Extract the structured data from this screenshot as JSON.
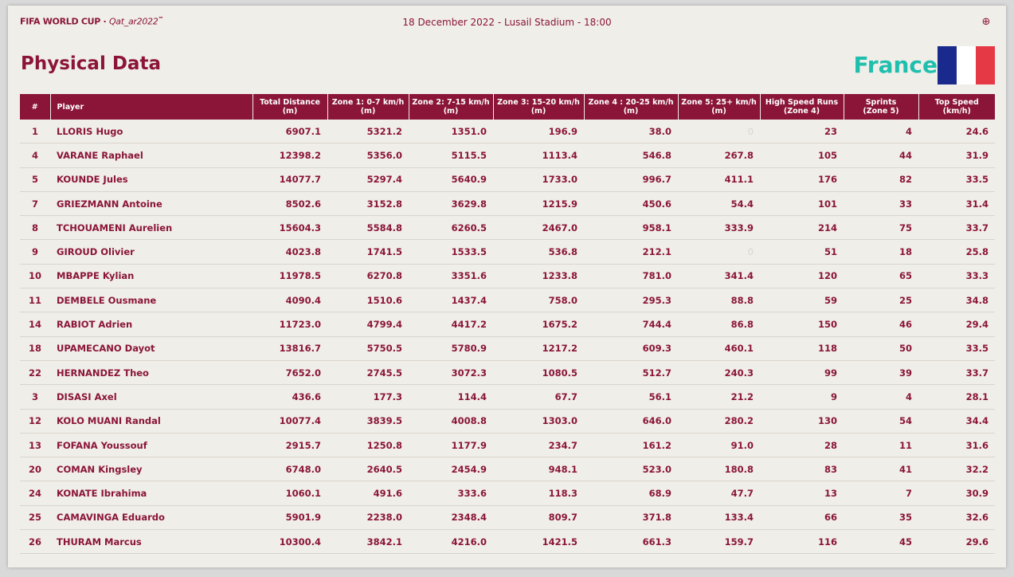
{
  "header": {
    "logo_text": "FIFA WORLD CUP",
    "logo_sub": "Qat_ar2022",
    "logo_tm": "™",
    "match_info": "18 December 2022 - Lusail Stadium - 18:00",
    "globe_icon": "globe-icon"
  },
  "title": "Physical Data",
  "team": {
    "name": "France",
    "flag_colors": [
      "#1a2a8c",
      "#ffffff",
      "#e63946"
    ]
  },
  "colors": {
    "primary": "#8a1538",
    "accent": "#1fbfae",
    "background": "#f0eee8"
  },
  "table": {
    "columns": [
      {
        "l1": "#",
        "l2": ""
      },
      {
        "l1": "Player",
        "l2": ""
      },
      {
        "l1": "Total Distance",
        "l2": "(m)"
      },
      {
        "l1": "Zone 1: 0-7 km/h",
        "l2": "(m)"
      },
      {
        "l1": "Zone 2: 7-15 km/h",
        "l2": "(m)"
      },
      {
        "l1": "Zone 3: 15-20 km/h",
        "l2": "(m)"
      },
      {
        "l1": "Zone 4 : 20-25 km/h",
        "l2": "(m)"
      },
      {
        "l1": "Zone 5: 25+ km/h",
        "l2": "(m)"
      },
      {
        "l1": "High Speed Runs",
        "l2": "(Zone 4)"
      },
      {
        "l1": "Sprints",
        "l2": "(Zone 5)"
      },
      {
        "l1": "Top Speed",
        "l2": "(km/h)"
      }
    ],
    "rows": [
      [
        "1",
        "LLORIS Hugo",
        "6907.1",
        "5321.2",
        "1351.0",
        "196.9",
        "38.0",
        "0",
        "23",
        "4",
        "24.6"
      ],
      [
        "4",
        "VARANE Raphael",
        "12398.2",
        "5356.0",
        "5115.5",
        "1113.4",
        "546.8",
        "267.8",
        "105",
        "44",
        "31.9"
      ],
      [
        "5",
        "KOUNDE Jules",
        "14077.7",
        "5297.4",
        "5640.9",
        "1733.0",
        "996.7",
        "411.1",
        "176",
        "82",
        "33.5"
      ],
      [
        "7",
        "GRIEZMANN Antoine",
        "8502.6",
        "3152.8",
        "3629.8",
        "1215.9",
        "450.6",
        "54.4",
        "101",
        "33",
        "31.4"
      ],
      [
        "8",
        "TCHOUAMENI Aurelien",
        "15604.3",
        "5584.8",
        "6260.5",
        "2467.0",
        "958.1",
        "333.9",
        "214",
        "75",
        "33.7"
      ],
      [
        "9",
        "GIROUD Olivier",
        "4023.8",
        "1741.5",
        "1533.5",
        "536.8",
        "212.1",
        "0",
        "51",
        "18",
        "25.8"
      ],
      [
        "10",
        "MBAPPE Kylian",
        "11978.5",
        "6270.8",
        "3351.6",
        "1233.8",
        "781.0",
        "341.4",
        "120",
        "65",
        "33.3"
      ],
      [
        "11",
        "DEMBELE Ousmane",
        "4090.4",
        "1510.6",
        "1437.4",
        "758.0",
        "295.3",
        "88.8",
        "59",
        "25",
        "34.8"
      ],
      [
        "14",
        "RABIOT Adrien",
        "11723.0",
        "4799.4",
        "4417.2",
        "1675.2",
        "744.4",
        "86.8",
        "150",
        "46",
        "29.4"
      ],
      [
        "18",
        "UPAMECANO Dayot",
        "13816.7",
        "5750.5",
        "5780.9",
        "1217.2",
        "609.3",
        "460.1",
        "118",
        "50",
        "33.5"
      ],
      [
        "22",
        "HERNANDEZ Theo",
        "7652.0",
        "2745.5",
        "3072.3",
        "1080.5",
        "512.7",
        "240.3",
        "99",
        "39",
        "33.7"
      ],
      [
        "3",
        "DISASI Axel",
        "436.6",
        "177.3",
        "114.4",
        "67.7",
        "56.1",
        "21.2",
        "9",
        "4",
        "28.1"
      ],
      [
        "12",
        "KOLO MUANI Randal",
        "10077.4",
        "3839.5",
        "4008.8",
        "1303.0",
        "646.0",
        "280.2",
        "130",
        "54",
        "34.4"
      ],
      [
        "13",
        "FOFANA Youssouf",
        "2915.7",
        "1250.8",
        "1177.9",
        "234.7",
        "161.2",
        "91.0",
        "28",
        "11",
        "31.6"
      ],
      [
        "20",
        "COMAN Kingsley",
        "6748.0",
        "2640.5",
        "2454.9",
        "948.1",
        "523.0",
        "180.8",
        "83",
        "41",
        "32.2"
      ],
      [
        "24",
        "KONATE Ibrahima",
        "1060.1",
        "491.6",
        "333.6",
        "118.3",
        "68.9",
        "47.7",
        "13",
        "7",
        "30.9"
      ],
      [
        "25",
        "CAMAVINGA Eduardo",
        "5901.9",
        "2238.0",
        "2348.4",
        "809.7",
        "371.8",
        "133.4",
        "66",
        "35",
        "32.6"
      ],
      [
        "26",
        "THURAM Marcus",
        "10300.4",
        "3842.1",
        "4216.0",
        "1421.5",
        "661.3",
        "159.7",
        "116",
        "45",
        "29.6"
      ]
    ]
  }
}
